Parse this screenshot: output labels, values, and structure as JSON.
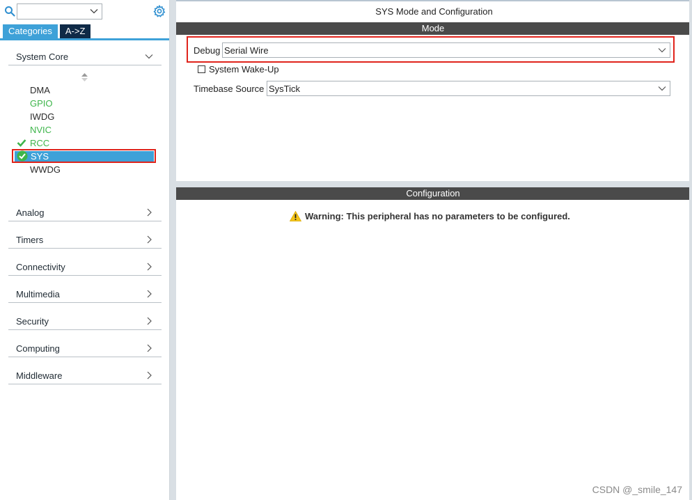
{
  "sidebar": {
    "search": {
      "value": ""
    },
    "tabs": [
      {
        "label": "Categories"
      },
      {
        "label": "A->Z"
      }
    ],
    "system_core": {
      "label": "System Core",
      "items": [
        {
          "label": "DMA",
          "status": "normal"
        },
        {
          "label": "GPIO",
          "status": "configured"
        },
        {
          "label": "IWDG",
          "status": "normal"
        },
        {
          "label": "NVIC",
          "status": "configured"
        },
        {
          "label": "RCC",
          "status": "checked"
        },
        {
          "label": "SYS",
          "status": "selected"
        },
        {
          "label": "WWDG",
          "status": "normal"
        }
      ]
    },
    "categories": [
      {
        "label": "Analog"
      },
      {
        "label": "Timers"
      },
      {
        "label": "Connectivity"
      },
      {
        "label": "Multimedia"
      },
      {
        "label": "Security"
      },
      {
        "label": "Computing"
      },
      {
        "label": "Middleware"
      }
    ]
  },
  "main": {
    "title": "SYS Mode and Configuration",
    "mode": {
      "header": "Mode",
      "debug_label": "Debug",
      "debug_value": "Serial Wire",
      "wakeup_label": "System Wake-Up",
      "wakeup_checked": false,
      "timebase_label": "Timebase Source",
      "timebase_value": "SysTick"
    },
    "configuration": {
      "header": "Configuration",
      "warning": "Warning: This peripheral has no parameters to be configured."
    }
  },
  "watermark": "CSDN @_smile_147",
  "colors": {
    "accent": "#3ea1d8",
    "tab_dark": "#0f2a47",
    "green": "#3db54a",
    "highlight_red": "#e0231b",
    "bar_dark": "#4a4a4a"
  }
}
